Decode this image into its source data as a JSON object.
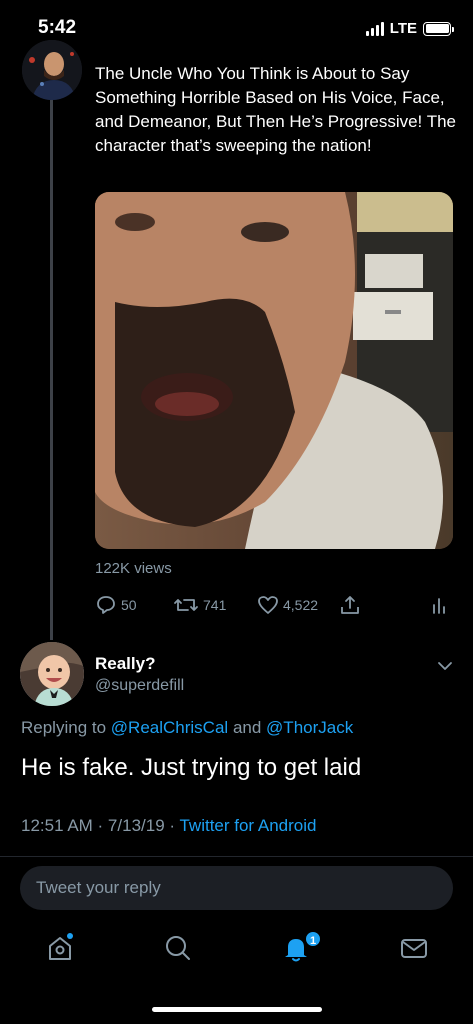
{
  "status": {
    "time": "5:42",
    "network": "LTE",
    "battery_level": 1.0
  },
  "tweet": {
    "text": "The Uncle Who You Think is About to Say Something Horrible Based on His Voice, Face, and Demeanor, But Then He’s Progressive! The character that’s sweeping the nation!",
    "views": "122K views",
    "replies": "50",
    "retweets": "741",
    "likes": "4,522"
  },
  "reply": {
    "name": "Really?",
    "handle": "@superdefill",
    "replying_prefix": "Replying to",
    "mention1": "@RealChrisCal",
    "conjunction": "and",
    "mention2": "@ThorJack",
    "text": "He is fake. Just trying to get laid",
    "timestamp": "12:51 AM · 7/13/19 · ",
    "source": "Twitter for Android"
  },
  "composer": {
    "placeholder": "Tweet your reply"
  },
  "tabs": {
    "notifications_badge": "1"
  },
  "colors": {
    "accent": "#1da1f2",
    "muted": "#8899a6",
    "background": "#000000"
  }
}
